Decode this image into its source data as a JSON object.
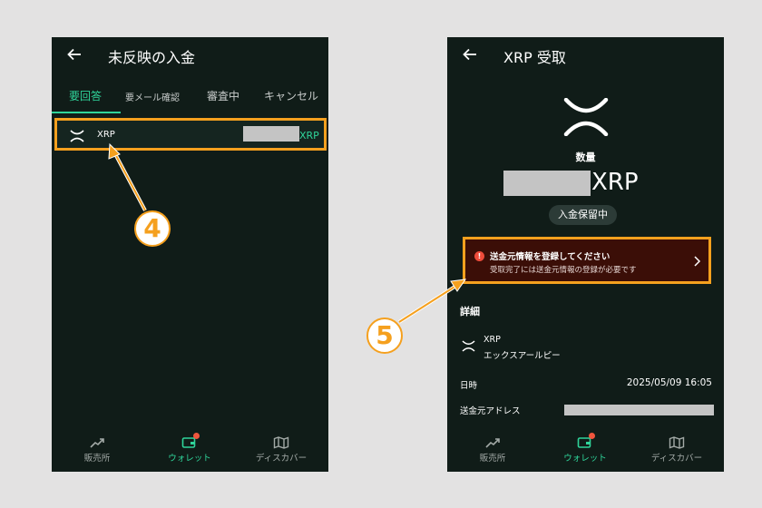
{
  "left_screen": {
    "title": "未反映の入金",
    "tabs": [
      {
        "label": "要回答",
        "active": true
      },
      {
        "label": "要メール確認",
        "active": false
      },
      {
        "label": "審査中",
        "active": false
      },
      {
        "label": "キャンセル",
        "active": false
      }
    ],
    "deposit": {
      "name": "XRP",
      "currency": "XRP",
      "icon": "xrp-icon"
    },
    "step_badge": "4"
  },
  "right_screen": {
    "title": "XRP 受取",
    "quantity_label": "数量",
    "amount_currency": "XRP",
    "status": "入金保留中",
    "warning": {
      "title": "送金元情報を登録してください",
      "body": "受取完了には送金元情報の登録が必要です",
      "icon": "alert-icon"
    },
    "details_title": "詳細",
    "asset": {
      "symbol": "XRP",
      "name": "エックスアールピー"
    },
    "date_label": "日時",
    "date_value": "2025/05/09 16:05",
    "address_label": "送金元アドレス",
    "step_badge": "5"
  },
  "bottom_nav": [
    {
      "label": "販売所",
      "icon": "trend-icon",
      "active": false
    },
    {
      "label": "ウォレット",
      "icon": "wallet-icon",
      "active": true
    },
    {
      "label": "ディスカバー",
      "icon": "map-icon",
      "active": false
    }
  ],
  "colors": {
    "background": "#101c18",
    "accent_green": "#2fd49a",
    "highlight_orange": "#f5a01e",
    "warning_bg": "#3b0e07"
  }
}
